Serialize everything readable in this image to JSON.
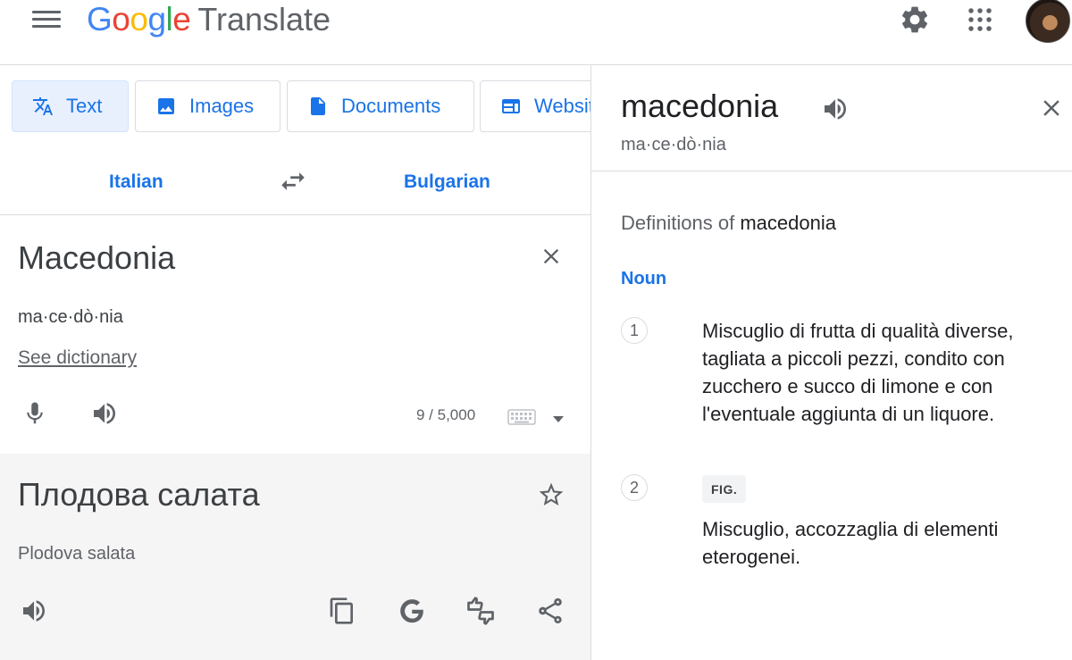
{
  "header": {
    "logo_google": "Google",
    "logo_translate": "Translate",
    "icons": [
      "menu-icon",
      "settings-gear-icon",
      "apps-grid-icon",
      "account-avatar"
    ]
  },
  "tabs": [
    {
      "label": "Text",
      "icon": "translate-icon",
      "active": true
    },
    {
      "label": "Images",
      "icon": "image-icon",
      "active": false
    },
    {
      "label": "Documents",
      "icon": "document-icon",
      "active": false
    },
    {
      "label": "Websites",
      "icon": "website-icon",
      "active": false
    }
  ],
  "languages": {
    "source": "Italian",
    "target": "Bulgarian"
  },
  "source": {
    "text": "Macedonia",
    "transliteration": "ma·ce·dò·nia",
    "see_dictionary": "See dictionary",
    "char_count": "9 / 5,000"
  },
  "target": {
    "text": "Плодова салата",
    "transliteration": "Plodova salata"
  },
  "dictionary": {
    "word": "macedonia",
    "syllables": "ma·ce·dò·nia",
    "definitions_prefix": "Definitions of",
    "definitions_word": "macedonia",
    "part_of_speech": "Noun",
    "entries": [
      {
        "number": "1",
        "label": "",
        "text": "Miscuglio di frutta di qualità diverse, tagliata a piccoli pezzi, condito con zucchero e succo di limone e con l'eventuale aggiunta di un liquore."
      },
      {
        "number": "2",
        "label": "FIG.",
        "text": "Miscuglio, accozzaglia di elementi eterogenei."
      }
    ]
  },
  "colors": {
    "accent": "#1a73e8",
    "active_tab_bg": "#e8f0fe",
    "target_bg": "#f5f5f5",
    "icon_gray": "#5f6368"
  }
}
